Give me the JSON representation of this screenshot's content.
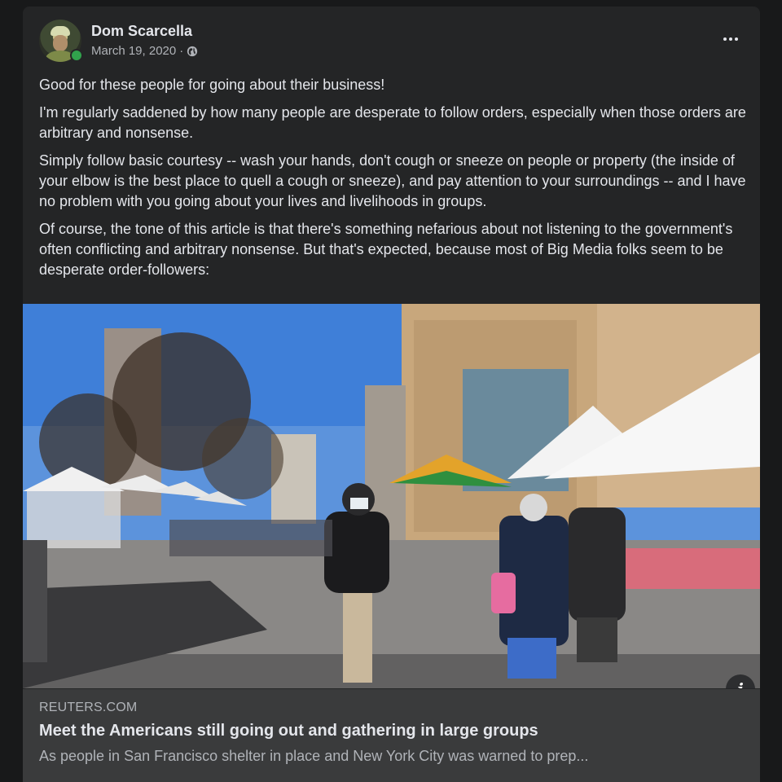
{
  "post": {
    "author": "Dom Scarcella",
    "date": "March 19, 2020",
    "separator": "·",
    "privacy_icon": "globe-icon",
    "more_icon": "more-options-icon",
    "paragraphs": [
      "Good for these people for going about their business!",
      "I'm regularly saddened by how many people are desperate to follow orders, especially when those orders are arbitrary and nonsense.",
      "Simply follow basic courtesy -- wash your hands, don't cough or sneeze on people or property (the inside of your elbow is the best place to quell a cough or sneeze), and pay attention to your surroundings -- and I have no problem with you going about your lives and livelihoods in groups.",
      "Of course, the tone of this article is that there's something nefarious about not listening to the government's often conflicting and arbitrary nonsense.  But that's expected, because most of Big Media folks seem to be desperate order-followers:"
    ]
  },
  "link": {
    "domain": "REUTERS.COM",
    "title": "Meet the Americans still going out and gathering in large groups",
    "description": "As people in San Francisco shelter in place and New York City was warned to prep...",
    "info_icon": "info-icon",
    "info_label": "i"
  },
  "colors": {
    "background": "#18191a",
    "card": "#242526",
    "link_box": "#3a3b3c",
    "primary_text": "#e4e6eb",
    "secondary_text": "#b0b3b8",
    "online": "#31a24c"
  }
}
